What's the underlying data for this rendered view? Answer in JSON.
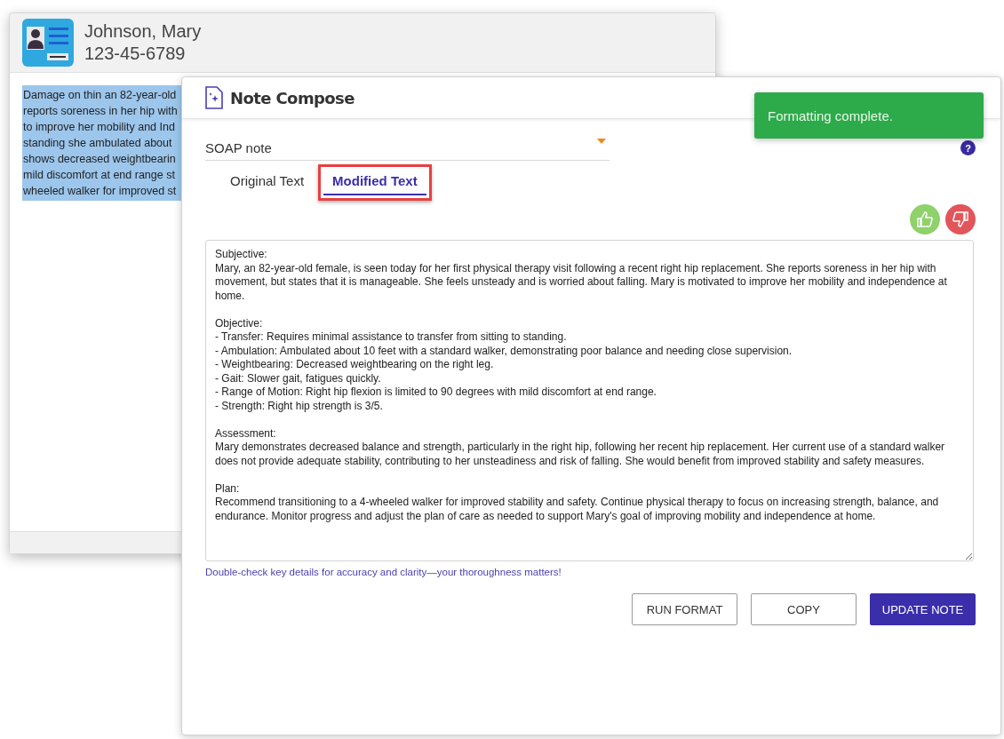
{
  "patient_window": {
    "name": "Johnson, Mary",
    "id_number": "123-45-6789",
    "selected_text_lines": [
      "Damage on thin an 82-year-old",
      "reports soreness in her hip with",
      "to improve her mobility and Ind",
      "standing she ambulated about",
      "shows decreased weightbearin",
      "mild discomfort at end range st",
      "wheeled walker for improved st"
    ]
  },
  "dialog": {
    "title": "Note Compose",
    "note_type": {
      "value": "SOAP note"
    },
    "help": {
      "label": "?"
    },
    "tabs": [
      {
        "label": "Original Text",
        "selected": false,
        "highlighted": false
      },
      {
        "label": "Modified Text",
        "selected": true,
        "highlighted": true
      }
    ],
    "note": {
      "text": "Subjective:\nMary, an 82-year-old female, is seen today for her first physical therapy visit following a recent right hip replacement. She reports soreness in her hip with movement, but states that it is manageable. She feels unsteady and is worried about falling. Mary is motivated to improve her mobility and independence at home.\n\nObjective:\n- Transfer: Requires minimal assistance to transfer from sitting to standing.\n- Ambulation: Ambulated about 10 feet with a standard walker, demonstrating poor balance and needing close supervision.\n- Weightbearing: Decreased weightbearing on the right leg.\n- Gait: Slower gait, fatigues quickly.\n- Range of Motion: Right hip flexion is limited to 90 degrees with mild discomfort at end range.\n- Strength: Right hip strength is 3/5.\n\nAssessment:\nMary demonstrates decreased balance and strength, particularly in the right hip, following her recent hip replacement. Her current use of a standard walker does not provide adequate stability, contributing to her unsteadiness and risk of falling. She would benefit from improved stability and safety measures.\n\nPlan:\nRecommend transitioning to a 4-wheeled walker for improved stability and safety. Continue physical therapy to focus on increasing strength, balance, and endurance. Monitor progress and adjust the plan of care as needed to support Mary's goal of improving mobility and independence at home."
    },
    "hint": "Double-check key details for accuracy and clarity—your thoroughness matters!",
    "buttons": [
      {
        "label": "RUN FORMAT",
        "kind": "outline"
      },
      {
        "label": "COPY",
        "kind": "outline"
      },
      {
        "label": "UPDATE NOTE",
        "kind": "primary"
      }
    ]
  },
  "toast": {
    "message": "Formatting complete."
  }
}
